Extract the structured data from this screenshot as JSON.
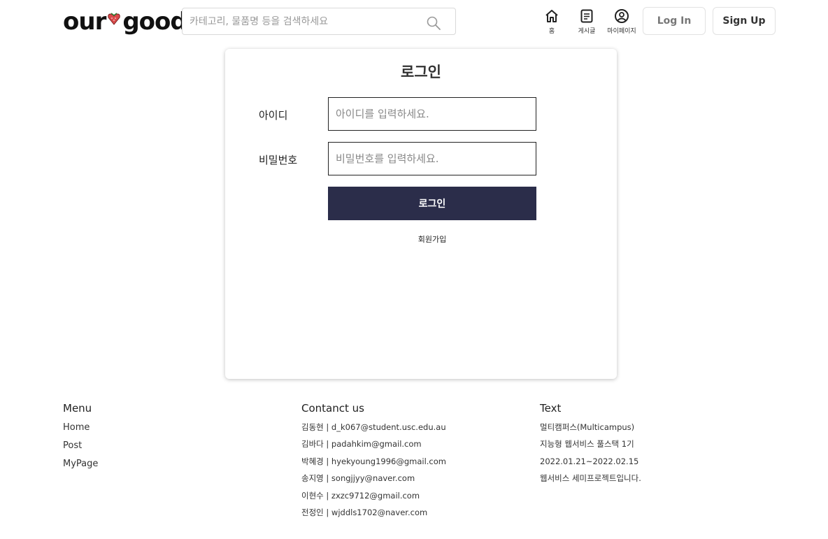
{
  "header": {
    "logo": {
      "left": "our",
      "right": "goods"
    },
    "search": {
      "placeholder": "카테고리, 물품명 등을 검색하세요"
    },
    "nav": [
      {
        "label": "홈",
        "icon": "home-icon"
      },
      {
        "label": "게시글",
        "icon": "document-icon"
      },
      {
        "label": "마이페이지",
        "icon": "user-circle-icon"
      }
    ],
    "login_label": "Log In",
    "signup_label": "Sign Up"
  },
  "login": {
    "title": "로그인",
    "id_label": "아이디",
    "id_placeholder": "아이디를 입력하세요.",
    "pw_label": "비밀번호",
    "pw_placeholder": "비밀번호를 입력하세요.",
    "submit_label": "로그인",
    "join_label": "회원가입"
  },
  "footer": {
    "menu": {
      "title": "Menu",
      "items": [
        "Home",
        "Post",
        "MyPage"
      ]
    },
    "contact": {
      "title": "Contanct us",
      "items": [
        "김동현 | d_k067@student.usc.edu.au",
        "김바다 | padahkim@gmail.com",
        "박혜경 | hyekyoung1996@gmail.com",
        "송지영 | songjjyy@naver.com",
        "이현수 | zxzc9712@gmail.com",
        "전정인 | wjddls1702@naver.com"
      ]
    },
    "text": {
      "title": "Text",
      "items": [
        "멀티캠퍼스(Multicampus)",
        "지능형 웹서비스 풀스택 1기",
        "2022.01.21~2022.02.15",
        "웹서비스 세미프로젝트입니다."
      ]
    }
  },
  "colors": {
    "primary_button": "#2b2d4a",
    "logo_heart": "#d94a4a"
  }
}
